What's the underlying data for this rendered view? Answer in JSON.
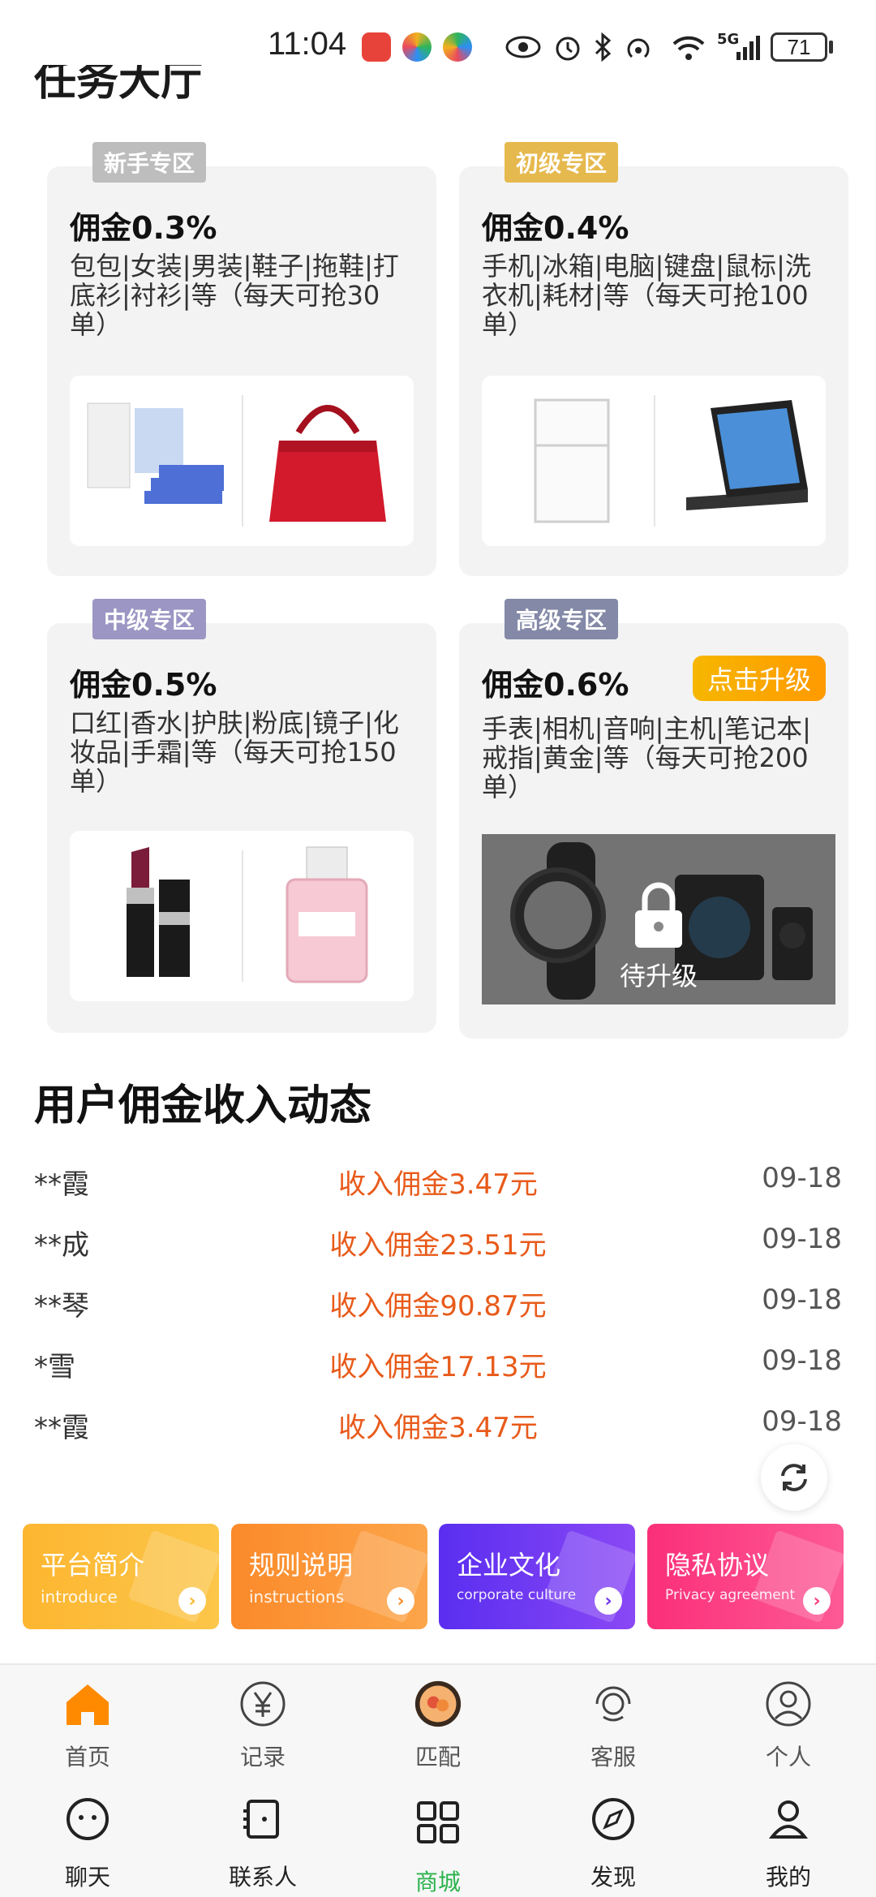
{
  "status_bar": {
    "time": "11:04",
    "signal_label": "5G",
    "battery": "71"
  },
  "section_title": "任务大厅",
  "zones": [
    {
      "tag": "新手专区",
      "tag_color": "#bdbdbd",
      "rate": "佣金0.3%",
      "desc": "包包|女装|男装|鞋子|拖鞋|打底衫|衬衫|等（每天可抢30单）",
      "locked": false
    },
    {
      "tag": "初级专区",
      "tag_color": "#e6b94e",
      "rate": "佣金0.4%",
      "desc": "手机|冰箱|电脑|键盘|鼠标|洗衣机|耗材|等（每天可抢100单）",
      "locked": false
    },
    {
      "tag": "中级专区",
      "tag_color": "#9b96c3",
      "rate": "佣金0.5%",
      "desc": "口红|香水|护肤|粉底|镜子|化妆品|手霜|等（每天可抢150单）",
      "locked": false
    },
    {
      "tag": "高级专区",
      "tag_color": "#8389a6",
      "rate": "佣金0.6%",
      "desc": "手表|相机|音响|主机|笔记本|戒指|黄金|等（每天可抢200单）",
      "locked": true,
      "upgrade_label": "点击升级",
      "lock_label": "待升级"
    }
  ],
  "feed": {
    "title": "用户佣金收入动态",
    "rows": [
      {
        "name": "**霞",
        "amount": "收入佣金3.47元",
        "date": "09-18"
      },
      {
        "name": "**成",
        "amount": "收入佣金23.51元",
        "date": "09-18"
      },
      {
        "name": "**琴",
        "amount": "收入佣金90.87元",
        "date": "09-18"
      },
      {
        "name": "*雪",
        "amount": "收入佣金17.13元",
        "date": "09-18"
      },
      {
        "name": "**霞",
        "amount": "收入佣金3.47元",
        "date": "09-18"
      }
    ]
  },
  "info_cards": [
    {
      "title": "平台简介",
      "subtitle": "introduce",
      "color": "#fcb92a"
    },
    {
      "title": "规则说明",
      "subtitle": "instructions",
      "color": "#fb8f2f"
    },
    {
      "title": "企业文化",
      "subtitle": "corporate culture",
      "color": "#6a31f0"
    },
    {
      "title": "隐私协议",
      "subtitle": "Privacy agreement",
      "color": "#fb3a7f"
    }
  ],
  "app_nav": [
    {
      "label": "首页",
      "icon": "home-icon",
      "active": true
    },
    {
      "label": "记录",
      "icon": "yen-icon"
    },
    {
      "label": "匹配",
      "icon": "match-icon"
    },
    {
      "label": "客服",
      "icon": "support-icon"
    },
    {
      "label": "个人",
      "icon": "user-icon"
    }
  ],
  "wx_nav": [
    {
      "label": "聊天",
      "icon": "chat-icon"
    },
    {
      "label": "联系人",
      "icon": "contacts-icon"
    },
    {
      "label": "商城",
      "icon": "grid-icon",
      "active": true
    },
    {
      "label": "发现",
      "icon": "compass-icon"
    },
    {
      "label": "我的",
      "icon": "person-icon"
    }
  ],
  "colors": {
    "accent_orange": "#ff8a00",
    "amount_red": "#e85a1a",
    "active_green": "#2bb24c"
  }
}
